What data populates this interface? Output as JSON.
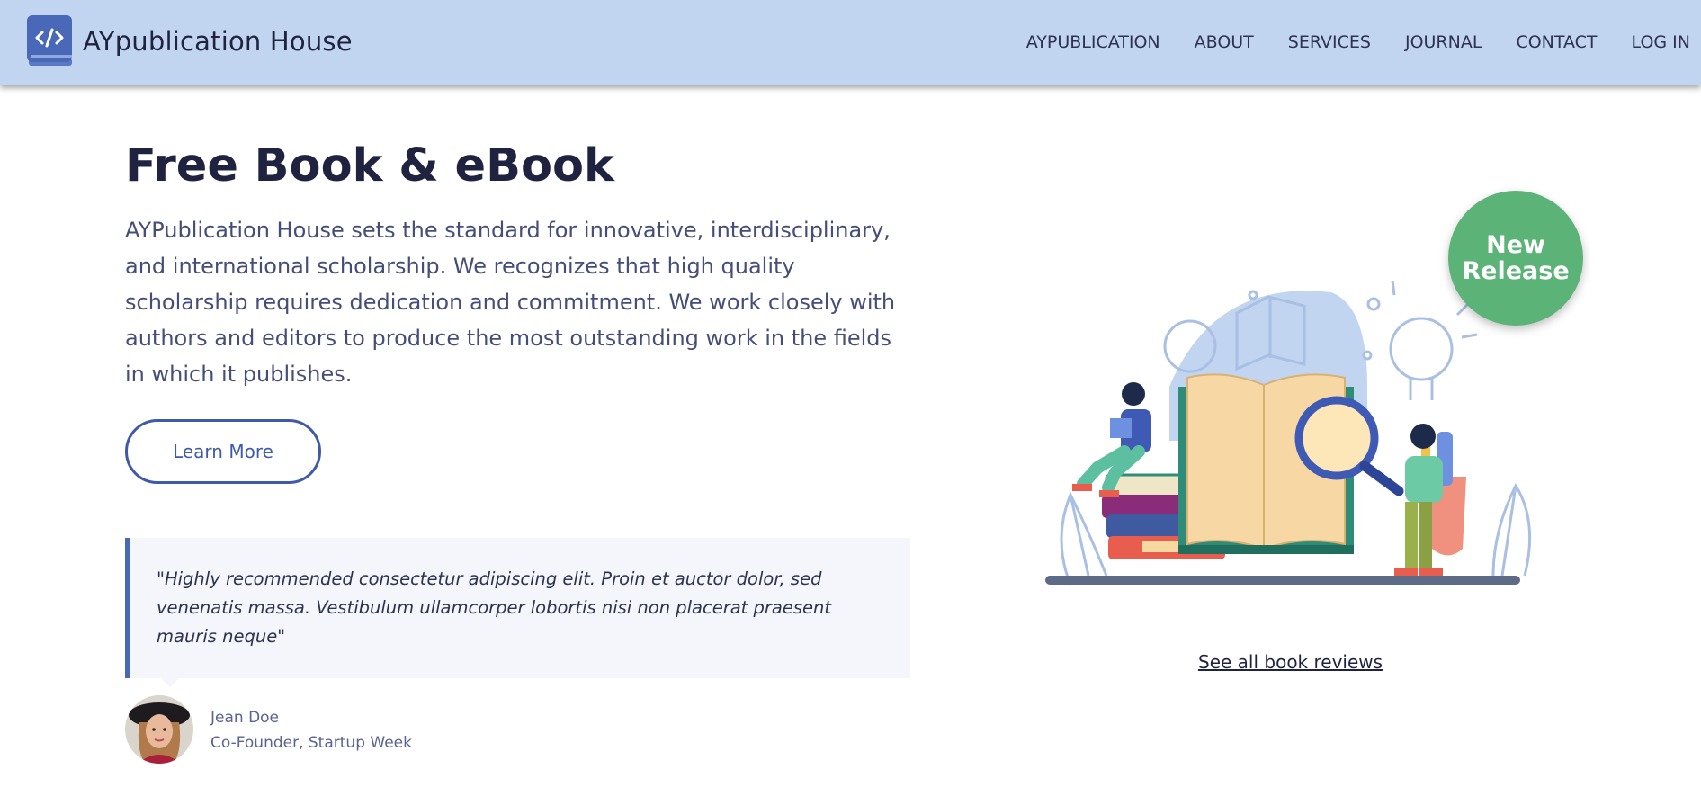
{
  "brand": {
    "name": "AYpublication House",
    "logo_icon": "code-book-icon"
  },
  "nav": {
    "items": [
      "AYPUBLICATION",
      "ABOUT",
      "SERVICES",
      "JOURNAL",
      "CONTACT",
      "LOG IN"
    ]
  },
  "hero": {
    "title": "Free Book & eBook",
    "description": "AYPublication House sets the standard for innovative, interdisciplinary, and international scholarship. We recognizes that high quality scholarship requires dedication and commitment. We work closely with authors and editors to produce the most outstanding work in the fields in which it publishes.",
    "cta_label": "Learn More"
  },
  "testimonial": {
    "quote": "\"Highly recommended consectetur adipiscing elit. Proin et auctor dolor, sed venenatis massa. Vestibulum ullamcorper lobortis nisi non placerat praesent mauris neque\"",
    "author_name": "Jean Doe",
    "author_role": "Co-Founder, Startup Week"
  },
  "badge": {
    "line1": "New",
    "line2": "Release"
  },
  "reviews": {
    "link_label": "See all book reviews"
  },
  "colors": {
    "navbar_bg": "#c1d5f1",
    "primary": "#3f5aa8",
    "badge_green": "#5cb377",
    "quote_bg": "#f4f6fb"
  }
}
